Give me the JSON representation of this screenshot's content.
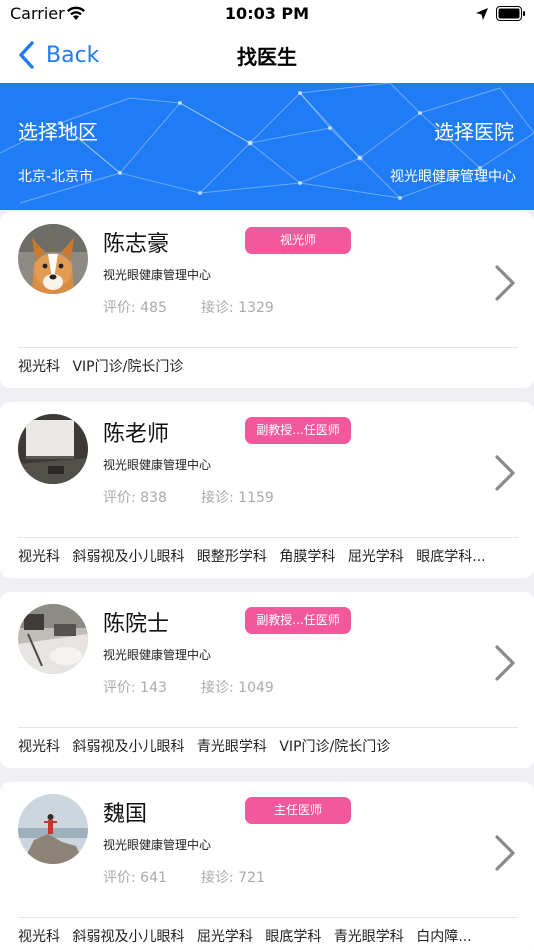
{
  "status_bar": {
    "carrier": "Carrier",
    "time": "10:03 PM"
  },
  "nav": {
    "back_label": "Back",
    "title": "找医生"
  },
  "filters": {
    "region_label": "选择地区",
    "region_value": "北京-北京市",
    "hospital_label": "选择医院",
    "hospital_value": "视光眼健康管理中心"
  },
  "colors": {
    "accent": "#1f7cf4",
    "badge": "#f2589b",
    "background": "#efeff4"
  },
  "doctors": [
    {
      "name": "陈志豪",
      "title": "视光师",
      "hospital": "视光眼健康管理中心",
      "rating": "评价: 485",
      "visits": "接诊: 1329",
      "avatar": "corgi-dog-photo",
      "departments": [
        "视光科",
        "VIP门诊/院长门诊"
      ]
    },
    {
      "name": "陈老师",
      "title": "副教授...任医师",
      "hospital": "视光眼健康管理中心",
      "rating": "评价: 838",
      "visits": "接诊: 1159",
      "avatar": "projector-room-photo",
      "departments": [
        "视光科",
        "斜弱视及小儿眼科",
        "眼整形学科",
        "角膜学科",
        "屈光学科",
        "眼底学科..."
      ]
    },
    {
      "name": "陈院士",
      "title": "副教授...任医师",
      "hospital": "视光眼健康管理中心",
      "rating": "评价: 143",
      "visits": "接诊: 1049",
      "avatar": "office-desk-photo",
      "departments": [
        "视光科",
        "斜弱视及小儿眼科",
        "青光眼学科",
        "VIP门诊/院长门诊"
      ]
    },
    {
      "name": "魏国",
      "title": "主任医师",
      "hospital": "视光眼健康管理中心",
      "rating": "评价: 641",
      "visits": "接诊: 721",
      "avatar": "seaside-rock-photo",
      "departments": [
        "视光科",
        "斜弱视及小儿眼科",
        "屈光学科",
        "眼底学科",
        "青光眼学科",
        "白内障..."
      ]
    }
  ]
}
